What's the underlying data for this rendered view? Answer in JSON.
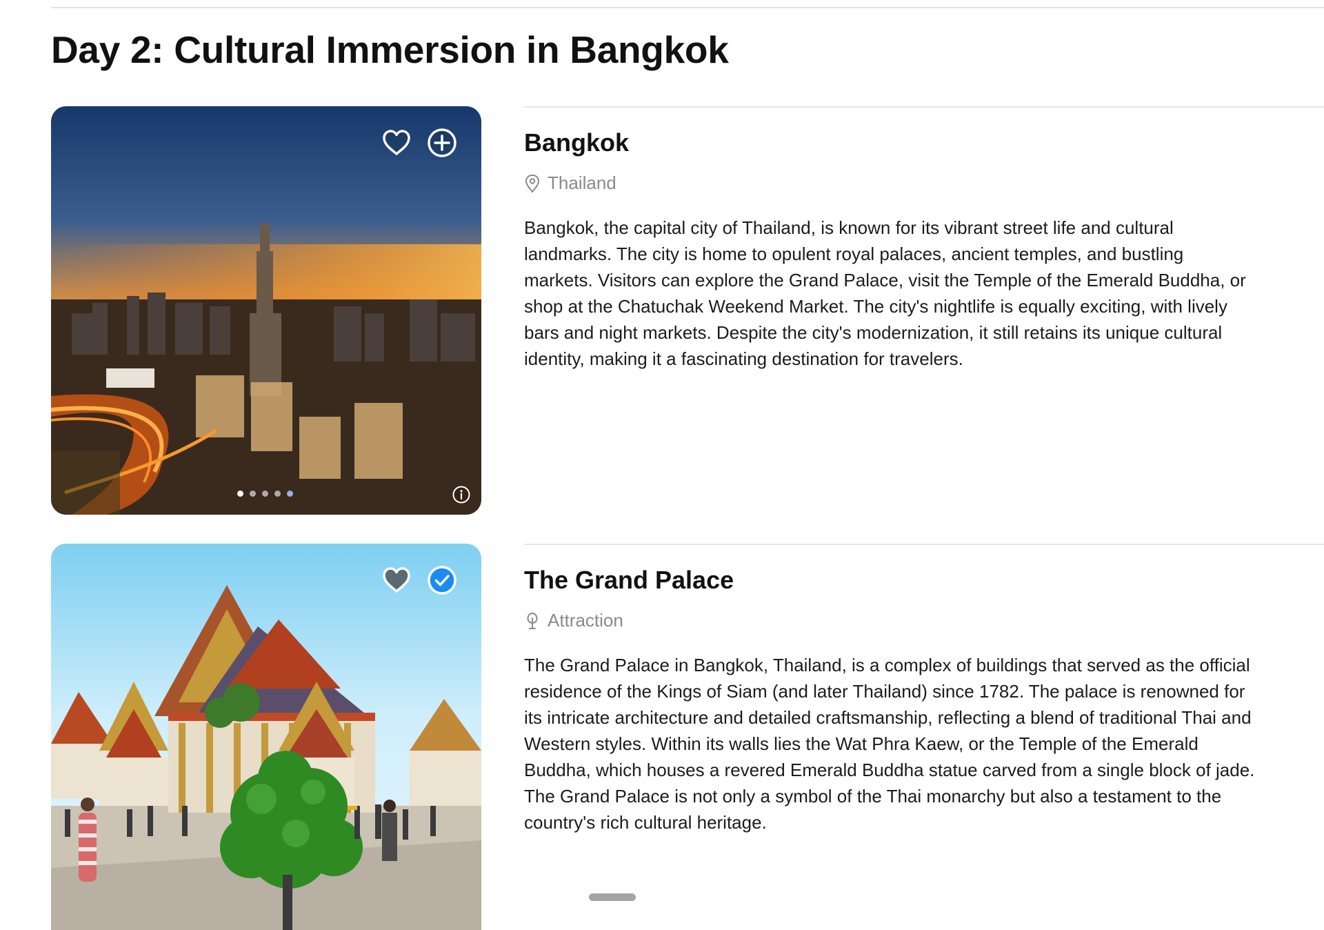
{
  "itinerary": {
    "day_title": "Day 2: Cultural Immersion in Bangkok",
    "items": [
      {
        "name": "Bangkok",
        "meta_icon": "map-pin-icon",
        "meta": "Thailand",
        "description": "Bangkok, the capital city of Thailand, is known for its vibrant street life and cultural landmarks. The city is home to opulent royal palaces, ancient temples, and bustling markets. Visitors can explore the Grand Palace, visit the Temple of the Emerald Buddha, or shop at the Chatuchak Weekend Market. The city's nightlife is equally exciting, with lively bars and night markets. Despite the city's modernization, it still retains its unique cultural identity, making it a fascinating destination for travelers.",
        "favorited": false,
        "added": false,
        "photo_count": 5,
        "active_photo": 1
      },
      {
        "name": "The Grand Palace",
        "meta_icon": "tree-icon",
        "meta": "Attraction",
        "description": "The Grand Palace in Bangkok, Thailand, is a complex of buildings that served as the official residence of the Kings of Siam (and later Thailand) since 1782. The palace is renowned for its intricate architecture and detailed craftsmanship, reflecting a blend of traditional Thai and Western styles. Within its walls lies the Wat Phra Kaew, or the Temple of the Emerald Buddha, which houses a revered Emerald Buddha statue carved from a single block of jade. The Grand Palace is not only a symbol of the Thai monarchy but also a testament to the country's rich cultural heritage.",
        "favorited": true,
        "added": true
      }
    ]
  },
  "colors": {
    "accent_blue": "#1a8cf0",
    "muted_text": "#8a8a8a",
    "favorite_fill": "#5a6a72"
  }
}
